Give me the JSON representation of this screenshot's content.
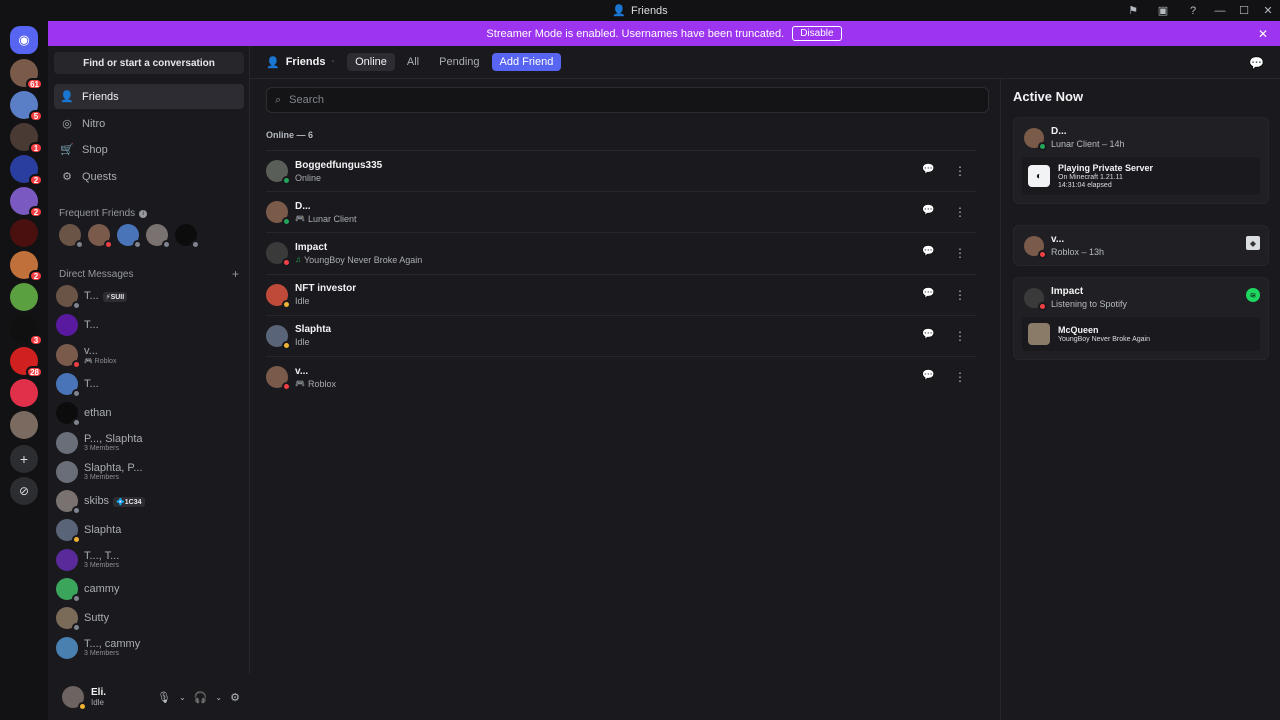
{
  "window": {
    "title": "Friends",
    "controls": [
      "—",
      "☐",
      "✕"
    ]
  },
  "banner": {
    "text": "Streamer Mode is enabled. Usernames have been truncated.",
    "button": "Disable"
  },
  "servers": [
    {
      "badge": "61",
      "color": "#7a5a48"
    },
    {
      "badge": "5",
      "color": "#5b7fc6"
    },
    {
      "badge": "1",
      "color": "#4a3a34"
    },
    {
      "badge": "2",
      "color": "#2a3ea0"
    },
    {
      "badge": "2",
      "color": "#7a5ac0"
    },
    {
      "badge": "",
      "color": "#4a1010"
    },
    {
      "badge": "2",
      "color": "#c0703a"
    },
    {
      "badge": "",
      "color": "#5aa040"
    },
    {
      "badge": "3",
      "color": "#101010"
    },
    {
      "badge": "28",
      "color": "#d02020"
    },
    {
      "badge": "",
      "color": "#e0304a"
    },
    {
      "badge": "",
      "color": "#7a6a60"
    }
  ],
  "sidebar": {
    "find": "Find or start a conversation",
    "nav": [
      {
        "label": "Friends",
        "icon": "👤"
      },
      {
        "label": "Nitro",
        "icon": "◎"
      },
      {
        "label": "Shop",
        "icon": "🛒"
      },
      {
        "label": "Quests",
        "icon": "⚙"
      }
    ],
    "frequent_label": "Frequent Friends",
    "dm_label": "Direct Messages",
    "dms": [
      {
        "name": "T...",
        "tag": "⚡SUII",
        "sub": "",
        "color": "#6a5446",
        "st": "off"
      },
      {
        "name": "T...",
        "tag": "",
        "sub": "",
        "color": "#5a1aa0",
        "st": ""
      },
      {
        "name": "v...",
        "tag": "",
        "sub": "🎮 Roblox",
        "color": "#7a5a4a",
        "st": "dnd"
      },
      {
        "name": "T...",
        "tag": "",
        "sub": "",
        "color": "#4a74b8",
        "st": "off"
      },
      {
        "name": "ethan",
        "tag": "",
        "sub": "",
        "color": "#0c0c0c",
        "st": "off"
      },
      {
        "name": "P..., Slaphta",
        "tag": "",
        "sub": "3 Members",
        "color": "#6a6e78",
        "st": ""
      },
      {
        "name": "Slaphta, P...",
        "tag": "",
        "sub": "3 Members",
        "color": "#6a6e78",
        "st": ""
      },
      {
        "name": "skibs",
        "tag": "💠1C34",
        "sub": "",
        "color": "#7a7270",
        "st": "off"
      },
      {
        "name": "Slaphta",
        "tag": "",
        "sub": "",
        "color": "#5a6478",
        "st": "idle"
      },
      {
        "name": "T..., T...",
        "tag": "",
        "sub": "3 Members",
        "color": "#5a2a9a",
        "st": ""
      },
      {
        "name": "cammy",
        "tag": "",
        "sub": "",
        "color": "#3ba55c",
        "st": "off"
      },
      {
        "name": "Sutty",
        "tag": "",
        "sub": "",
        "color": "#7a6a58",
        "st": "off"
      },
      {
        "name": "T..., cammy",
        "tag": "",
        "sub": "3 Members",
        "color": "#4a80b0",
        "st": ""
      }
    ],
    "user": {
      "name": "Eli.",
      "status": "Idle"
    }
  },
  "topbar": {
    "title": "Friends",
    "tabs": [
      "Online",
      "All",
      "Pending"
    ],
    "add": "Add Friend"
  },
  "main": {
    "search_placeholder": "Search",
    "online_count": "Online — 6",
    "friends": [
      {
        "name": "Boggedfungus335",
        "status": "Online",
        "color": "#5a5e58",
        "st": "online",
        "icon": ""
      },
      {
        "name": "D...",
        "status": "Lunar Client",
        "color": "#7a5a48",
        "st": "online",
        "icon": "🎮"
      },
      {
        "name": "Impact",
        "status": "YoungBoy Never Broke Again",
        "color": "#3a3a3a",
        "st": "dnd",
        "icon": "♫"
      },
      {
        "name": "NFT investor",
        "status": "Idle",
        "color": "#c04a3a",
        "st": "idle",
        "icon": ""
      },
      {
        "name": "Slaphta",
        "status": "Idle",
        "color": "#5a6478",
        "st": "idle",
        "icon": ""
      },
      {
        "name": "v...",
        "status": "Roblox",
        "color": "#7a5a4a",
        "st": "dnd",
        "icon": "🎮"
      }
    ]
  },
  "active_now": {
    "title": "Active Now",
    "cards": [
      {
        "name": "D...",
        "sub": "Lunar Client – 14h",
        "color": "#7a5a48",
        "st": "online",
        "inner": {
          "title": "Playing Private Server",
          "line1": "On Minecraft 1.21.11",
          "line2": "14:31:04 elapsed"
        }
      },
      {
        "name": "v...",
        "sub": "Roblox – 13h",
        "color": "#7a5a4a",
        "st": "dnd"
      },
      {
        "name": "Impact",
        "sub": "Listening to Spotify",
        "color": "#3a3a3a",
        "st": "dnd",
        "inner": {
          "title": "McQueen",
          "line1": "YoungBoy Never Broke Again",
          "line2": ""
        }
      }
    ]
  }
}
